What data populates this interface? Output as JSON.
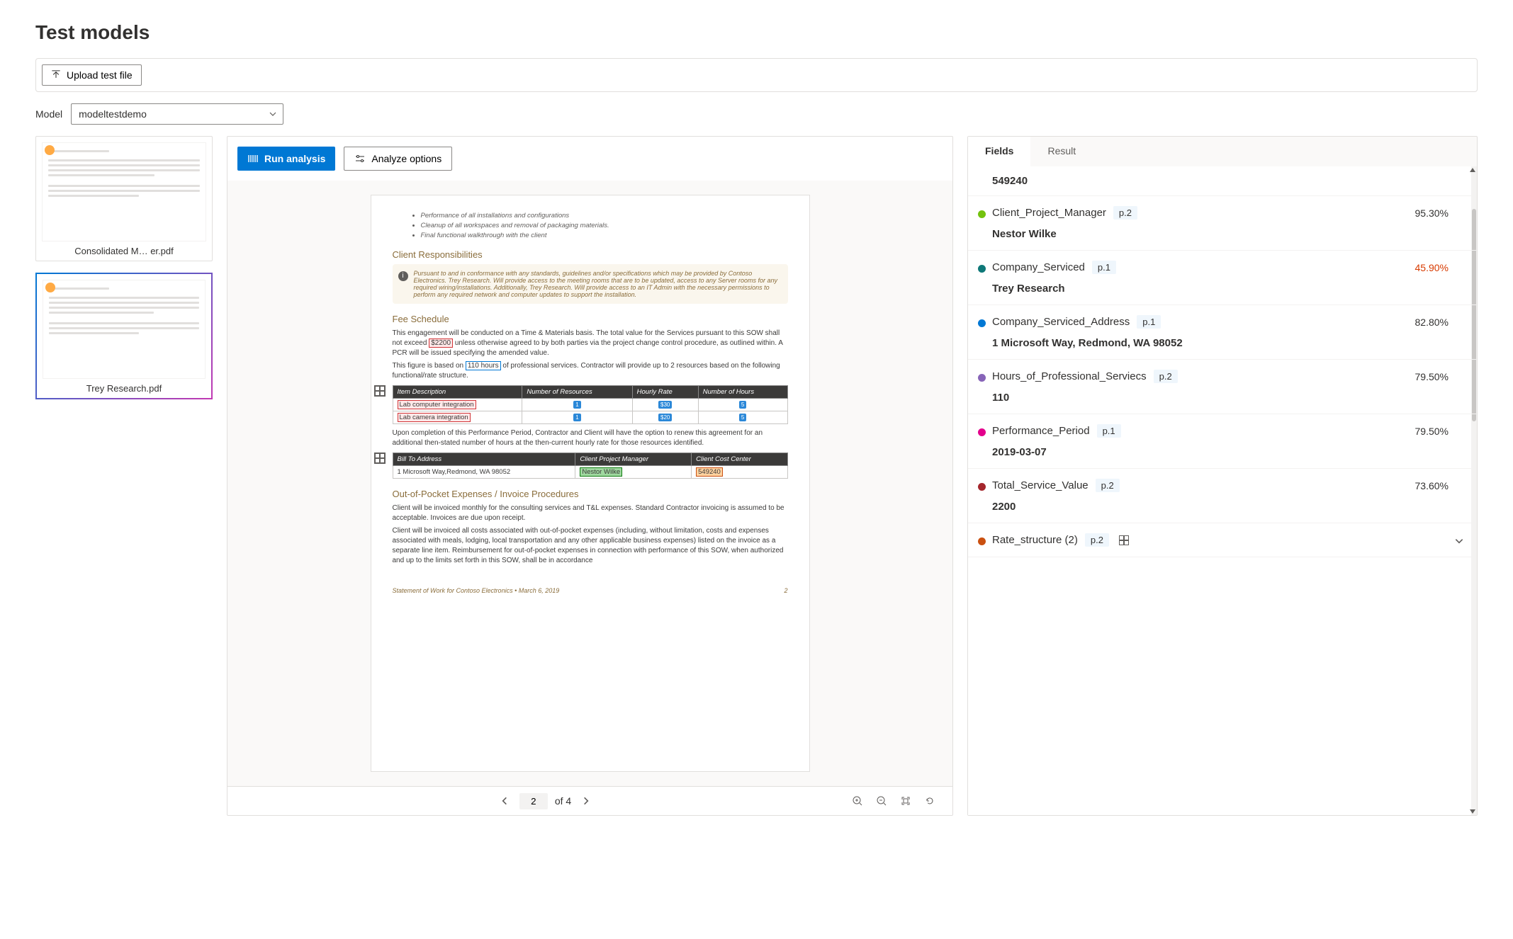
{
  "page_title": "Test models",
  "upload_button": "Upload test file",
  "model_label": "Model",
  "model_selected": "modeltestdemo",
  "thumbnails": [
    {
      "label": "Consolidated M… er.pdf",
      "selected": false
    },
    {
      "label": "Trey Research.pdf",
      "selected": true
    }
  ],
  "toolbar": {
    "run_analysis": "Run analysis",
    "analyze_options": "Analyze options"
  },
  "document": {
    "bullets": [
      "Performance of all installations and configurations",
      "Cleanup of all workspaces and removal of packaging materials.",
      "Final functional walkthrough with the client"
    ],
    "section_client_resp": "Client Responsibilities",
    "client_resp_note": "Pursuant to and in conformance with any standards, guidelines and/or specifications which may be provided by Contoso Electronics. Trey Research. Will provide access to the meeting rooms that are to be updated, access to any Server rooms for any required wiring/installations. Additionally, Trey Research. Will provide access to an IT Admin with the necessary permissions to perform any required network and computer updates to support the installation.",
    "section_fee": "Fee Schedule",
    "fee_p1a": "This engagement will be conducted on a Time & Materials basis. The total value for the Services pursuant to this SOW shall not exceed ",
    "fee_total": "$2200",
    "fee_p1b": " unless otherwise agreed to by both parties via the project change control procedure, as outlined within. A PCR will be issued specifying the amended value.",
    "fee_p2a": "This figure is based on ",
    "fee_hours": "110 hours",
    "fee_p2b": " of professional services. Contractor will provide up to 2 resources based on the following functional/rate structure.",
    "fee_table": {
      "headers": [
        "Item Description",
        "Number of Resources",
        "Hourly Rate",
        "Number of Hours"
      ],
      "rows": [
        [
          "Lab computer integration",
          "1",
          "$30",
          "5"
        ],
        [
          "Lab camera integration",
          "1",
          "$20",
          "5"
        ]
      ]
    },
    "fee_p3": "Upon completion of this Performance Period, Contractor and Client will have the option to renew this agreement for an additional then-stated number of hours at the then-current hourly rate for those resources identified.",
    "bill_table": {
      "headers": [
        "Bill To Address",
        "Client Project Manager",
        "Client Cost Center"
      ],
      "rows": [
        [
          "1 Microsoft Way,Redmond, WA 98052",
          "Nestor Wilke",
          "549240"
        ]
      ]
    },
    "section_oop": "Out-of-Pocket Expenses / Invoice Procedures",
    "oop_p1": "Client will be invoiced monthly for the consulting services and T&L expenses. Standard Contractor invoicing is assumed to be acceptable. Invoices are due upon receipt.",
    "oop_p2": "Client will be invoiced all costs associated with out-of-pocket expenses (including, without limitation, costs and expenses associated with meals, lodging, local transportation and any other applicable business expenses) listed on the invoice as a separate line item. Reimbursement for out-of-pocket expenses in connection with performance of this SOW, when authorized and up to the limits set forth in this SOW, shall be in accordance",
    "footer_left": "Statement of Work for Contoso Electronics • March 6, 2019",
    "footer_right": "2"
  },
  "pager": {
    "current": "2",
    "total_label": "of 4"
  },
  "tabs": {
    "fields": "Fields",
    "result": "Result"
  },
  "top_value": "549240",
  "fields": [
    {
      "color": "#73c20e",
      "name": "Client_Project_Manager",
      "page": "p.2",
      "conf": "95.30%",
      "low": false,
      "value": "Nestor Wilke"
    },
    {
      "color": "#0e7878",
      "name": "Company_Serviced",
      "page": "p.1",
      "conf": "45.90%",
      "low": true,
      "value": "Trey Research"
    },
    {
      "color": "#0078d4",
      "name": "Company_Serviced_Address",
      "page": "p.1",
      "conf": "82.80%",
      "low": false,
      "value": "1 Microsoft Way, Redmond, WA 98052"
    },
    {
      "color": "#8764b8",
      "name": "Hours_of_Professional_Serviecs",
      "page": "p.2",
      "conf": "79.50%",
      "low": false,
      "value": "110"
    },
    {
      "color": "#e3008c",
      "name": "Performance_Period",
      "page": "p.1",
      "conf": "79.50%",
      "low": false,
      "value": "2019-03-07"
    },
    {
      "color": "#a4262c",
      "name": "Total_Service_Value",
      "page": "p.2",
      "conf": "73.60%",
      "low": false,
      "value": "2200"
    },
    {
      "color": "#ca5010",
      "name": "Rate_structure (2)",
      "page": "p.2",
      "conf": "",
      "low": false,
      "value": "",
      "table": true
    }
  ]
}
